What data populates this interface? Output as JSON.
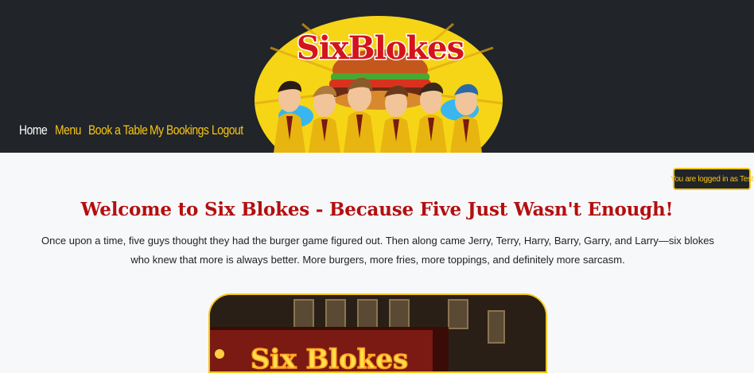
{
  "nav": {
    "items": [
      {
        "label": "Home"
      },
      {
        "label": "Menu"
      },
      {
        "label": "Book a Table"
      },
      {
        "label": "My Bookings"
      },
      {
        "label": "Logout"
      }
    ]
  },
  "logo": {
    "text": "SixBlokes"
  },
  "login_status": "You are logged in as Test",
  "main": {
    "heading": "Welcome to Six Blokes - Because Five Just Wasn't Enough!",
    "intro": "Once upon a time, five guys thought they had the burger game figured out. Then along came Jerry, Terry, Harry, Barry, Garry, and Larry—six blokes who knew that more is always better. More burgers, more fries, more toppings, and definitely more sarcasm.",
    "hero_sign": "Six Blokes"
  },
  "colors": {
    "header_bg": "#212428",
    "accent_yellow": "#f5c518",
    "heading_red": "#b40f0f",
    "page_bg": "#f7f8fa"
  }
}
